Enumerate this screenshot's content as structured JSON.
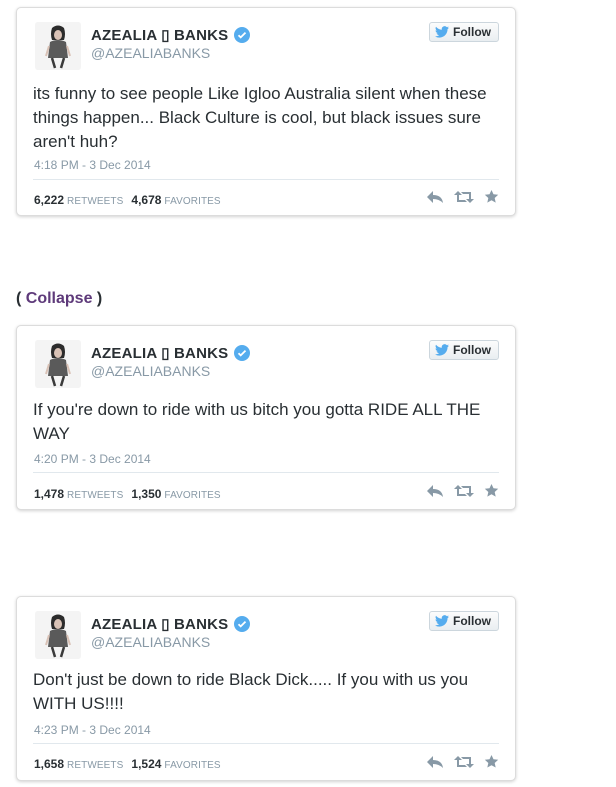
{
  "collapse": {
    "open": "(",
    "link": "Collapse",
    "close": ")"
  },
  "tweets": [
    {
      "name": "AZEALIA ▯ BANKS",
      "handle": "@AZEALIABANKS",
      "follow_label": "Follow",
      "text": "its funny to see people Like Igloo Australia silent when these things happen... Black Culture is cool, but black issues sure aren't huh?",
      "timestamp": "4:18 PM - 3 Dec 2014",
      "retweets": "6,222",
      "retweets_label": "RETWEETS",
      "favorites": "4,678",
      "favorites_label": "FAVORITES"
    },
    {
      "name": "AZEALIA ▯ BANKS",
      "handle": "@AZEALIABANKS",
      "follow_label": "Follow",
      "text": "If you're down to ride with us bitch you gotta RIDE ALL THE WAY",
      "timestamp": "4:20 PM - 3 Dec 2014",
      "retweets": "1,478",
      "retweets_label": "RETWEETS",
      "favorites": "1,350",
      "favorites_label": "FAVORITES"
    },
    {
      "name": "AZEALIA ▯ BANKS",
      "handle": "@AZEALIABANKS",
      "follow_label": "Follow",
      "text": "Don't just be down to ride Black Dick..... If you with us you WITH US!!!!",
      "timestamp": "4:23 PM - 3 Dec 2014",
      "retweets": "1,658",
      "retweets_label": "RETWEETS",
      "favorites": "1,524",
      "favorites_label": "FAVORITES"
    }
  ],
  "icons": {
    "verified": "verified-badge-icon",
    "bird": "twitter-bird-icon",
    "reply": "reply-icon",
    "retweet": "retweet-icon",
    "favorite": "star-icon"
  },
  "colors": {
    "verified": "#55acee",
    "bird": "#55acee",
    "collapse_link": "#5e3a7a",
    "muted": "#8899a6",
    "action_icon": "#8899a6"
  }
}
